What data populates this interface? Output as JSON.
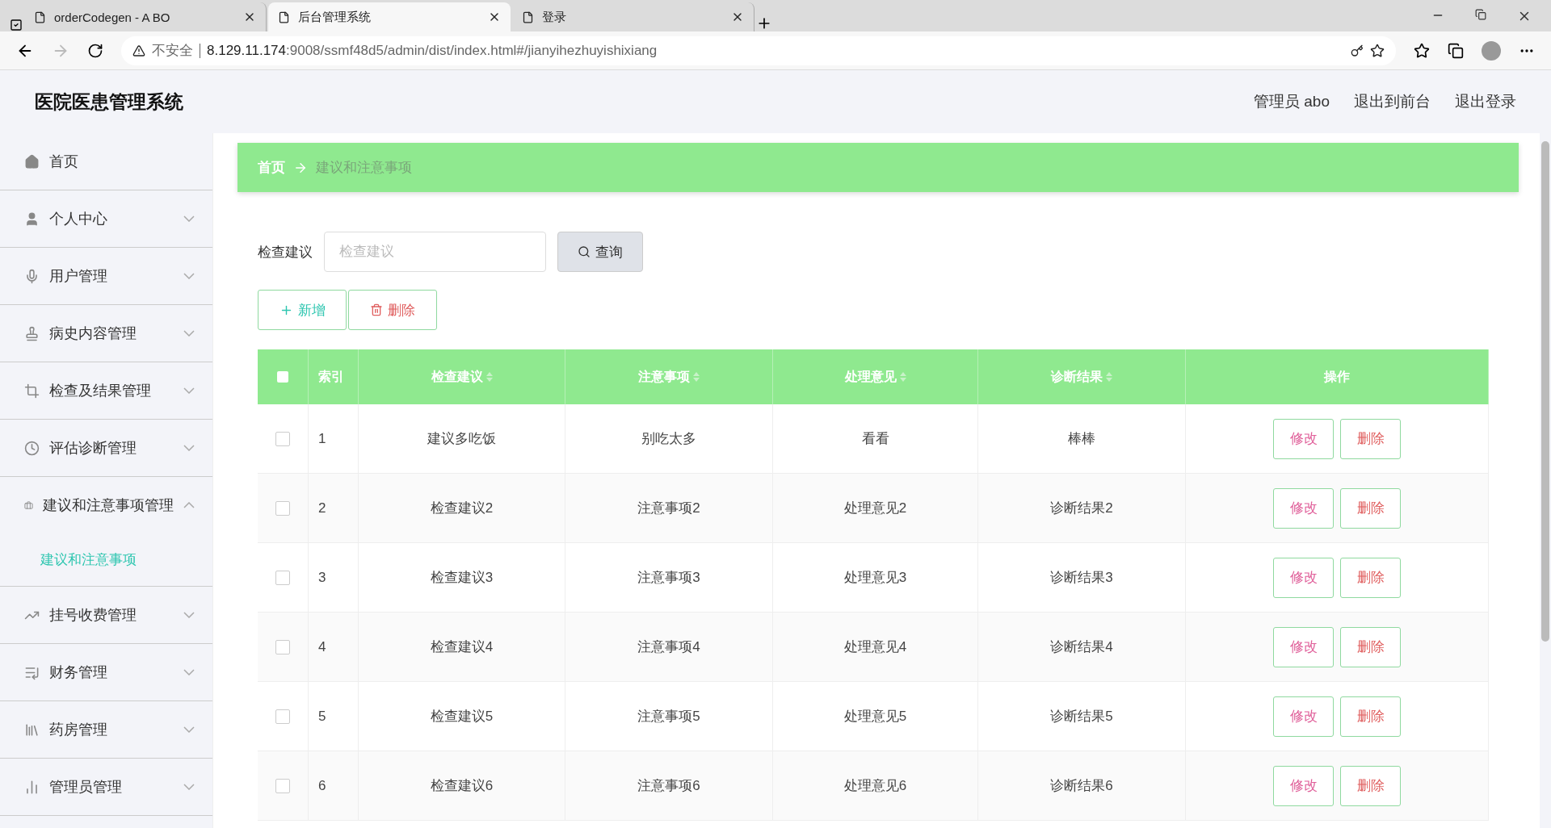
{
  "browser": {
    "tabs": [
      {
        "title": "orderCodegen - A BO",
        "selected": false
      },
      {
        "title": "后台管理系统",
        "selected": true
      },
      {
        "title": "登录",
        "selected": false
      }
    ],
    "security": "不安全",
    "url_host": "8.129.11.174",
    "url_path": ":9008/ssmf48d5/admin/dist/index.html#/jianyihezhuyishixiang"
  },
  "header": {
    "title": "医院医患管理系统",
    "user": "管理员 abo",
    "links": [
      "退出到前台",
      "退出登录"
    ]
  },
  "sidebar": {
    "items": [
      {
        "label": "首页",
        "kind": "link"
      },
      {
        "label": "个人中心",
        "kind": "menu",
        "expanded": false
      },
      {
        "label": "用户管理",
        "kind": "menu",
        "expanded": false
      },
      {
        "label": "病史内容管理",
        "kind": "menu",
        "expanded": false
      },
      {
        "label": "检查及结果管理",
        "kind": "menu",
        "expanded": false
      },
      {
        "label": "评估诊断管理",
        "kind": "menu",
        "expanded": false
      },
      {
        "label": "建议和注意事项管理",
        "kind": "menu",
        "expanded": true,
        "children": [
          {
            "label": "建议和注意事项",
            "selected": true
          }
        ]
      },
      {
        "label": "挂号收费管理",
        "kind": "menu",
        "expanded": false
      },
      {
        "label": "财务管理",
        "kind": "menu",
        "expanded": false
      },
      {
        "label": "药房管理",
        "kind": "menu",
        "expanded": false
      },
      {
        "label": "管理员管理",
        "kind": "menu",
        "expanded": false
      }
    ]
  },
  "breadcrumb": [
    "首页",
    "建议和注意事项"
  ],
  "search": {
    "label": "检查建议",
    "placeholder": "检查建议",
    "button": "查询"
  },
  "actions": [
    "新增",
    "删除"
  ],
  "table": {
    "all_checked": false,
    "columns": [
      {
        "label": "索引",
        "sortable": false
      },
      {
        "label": "检查建议",
        "sortable": true
      },
      {
        "label": "注意事项",
        "sortable": true
      },
      {
        "label": "处理意见",
        "sortable": true
      },
      {
        "label": "诊断结果",
        "sortable": true
      },
      {
        "label": "操作",
        "sortable": false
      }
    ],
    "rows": [
      {
        "checked": false,
        "cells": [
          "1",
          "建议多吃饭",
          "别吃太多",
          "看看",
          "棒棒"
        ],
        "buttons": [
          "修改",
          "删除"
        ]
      },
      {
        "checked": false,
        "cells": [
          "2",
          "检查建议2",
          "注意事项2",
          "处理意见2",
          "诊断结果2"
        ],
        "buttons": [
          "修改",
          "删除"
        ]
      },
      {
        "checked": false,
        "cells": [
          "3",
          "检查建议3",
          "注意事项3",
          "处理意见3",
          "诊断结果3"
        ],
        "buttons": [
          "修改",
          "删除"
        ]
      },
      {
        "checked": false,
        "cells": [
          "4",
          "检查建议4",
          "注意事项4",
          "处理意见4",
          "诊断结果4"
        ],
        "buttons": [
          "修改",
          "删除"
        ]
      },
      {
        "checked": false,
        "cells": [
          "5",
          "检查建议5",
          "注意事项5",
          "处理意见5",
          "诊断结果5"
        ],
        "buttons": [
          "修改",
          "删除"
        ]
      },
      {
        "checked": false,
        "cells": [
          "6",
          "检查建议6",
          "注意事项6",
          "处理意见6",
          "诊断结果6"
        ],
        "buttons": [
          "修改",
          "删除"
        ]
      }
    ]
  }
}
